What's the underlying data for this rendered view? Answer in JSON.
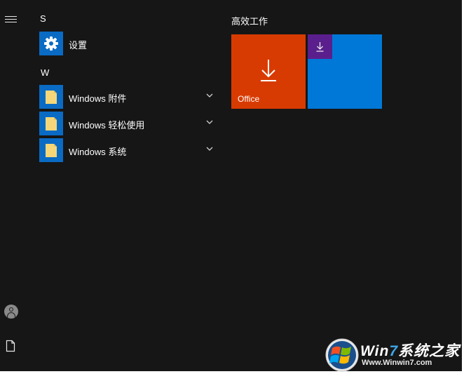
{
  "start_menu": {
    "app_list": {
      "sections": [
        {
          "letter": "S",
          "items": [
            {
              "label": "设置",
              "icon": "gear-icon",
              "expandable": false
            }
          ]
        },
        {
          "letter": "W",
          "items": [
            {
              "label": "Windows 附件",
              "icon": "folder-icon",
              "expandable": true
            },
            {
              "label": "Windows 轻松使用",
              "icon": "folder-icon",
              "expandable": true
            },
            {
              "label": "Windows 系统",
              "icon": "folder-icon",
              "expandable": true
            }
          ]
        }
      ]
    },
    "tiles": {
      "group_title": "高效工作",
      "items": [
        {
          "label": "Office",
          "icon": "download-arrow-icon",
          "color": "#d83b01"
        },
        {
          "label": "",
          "icon": "",
          "color": "#0078d7"
        },
        {
          "label": "",
          "icon": "download-arrow-icon",
          "color": "#5a1f8c"
        }
      ]
    },
    "rail": {
      "icons": [
        "hamburger-menu-icon",
        "user-avatar-icon",
        "document-icon"
      ]
    },
    "colors": {
      "background": "#161616",
      "app_icon_blue": "#0a6bc4"
    }
  },
  "watermark": {
    "brand_prefix": "Win",
    "brand_number": "7",
    "brand_suffix": "系统之家",
    "url": "Www.Winwin7.com"
  }
}
